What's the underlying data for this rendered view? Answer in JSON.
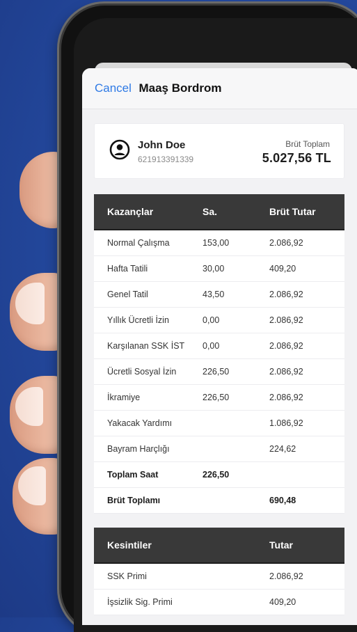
{
  "nav": {
    "cancel_label": "Cancel",
    "title": "Maaş Bordrom"
  },
  "user": {
    "name": "John Doe",
    "id": "621913391339"
  },
  "summary": {
    "label": "Brüt Toplam",
    "value": "5.027,56 TL"
  },
  "earnings": {
    "headers": [
      "Kazançlar",
      "Sa.",
      "Brüt Tutar"
    ],
    "rows": [
      [
        "Normal Çalışma",
        "153,00",
        "2.086,92"
      ],
      [
        "Hafta Tatili",
        "30,00",
        "409,20"
      ],
      [
        "Genel Tatil",
        "43,50",
        "2.086,92"
      ],
      [
        "Yıllık Ücretli İzin",
        "0,00",
        "2.086,92"
      ],
      [
        "Karşılanan SSK İST",
        "0,00",
        "2.086,92"
      ],
      [
        "Ücretli Sosyal İzin",
        "226,50",
        "2.086,92"
      ],
      [
        "İkramiye",
        "226,50",
        "2.086,92"
      ],
      [
        "Yakacak Yardımı",
        "",
        "1.086,92"
      ],
      [
        "Bayram Harçlığı",
        "",
        "224,62"
      ]
    ],
    "totals": [
      [
        "Toplam Saat",
        "226,50",
        ""
      ],
      [
        "Brüt Toplamı",
        "",
        "690,48"
      ]
    ]
  },
  "deductions": {
    "headers": [
      "Kesintiler",
      "",
      "Tutar"
    ],
    "rows": [
      [
        "SSK Primi",
        "",
        "2.086,92"
      ],
      [
        "İşsizlik Sig. Primi",
        "",
        "409,20"
      ]
    ]
  },
  "icons": {
    "user": "user-circle-icon"
  },
  "colors": {
    "accent": "#2f7ae5",
    "header_bg": "#393939",
    "background": "#244aa0"
  }
}
